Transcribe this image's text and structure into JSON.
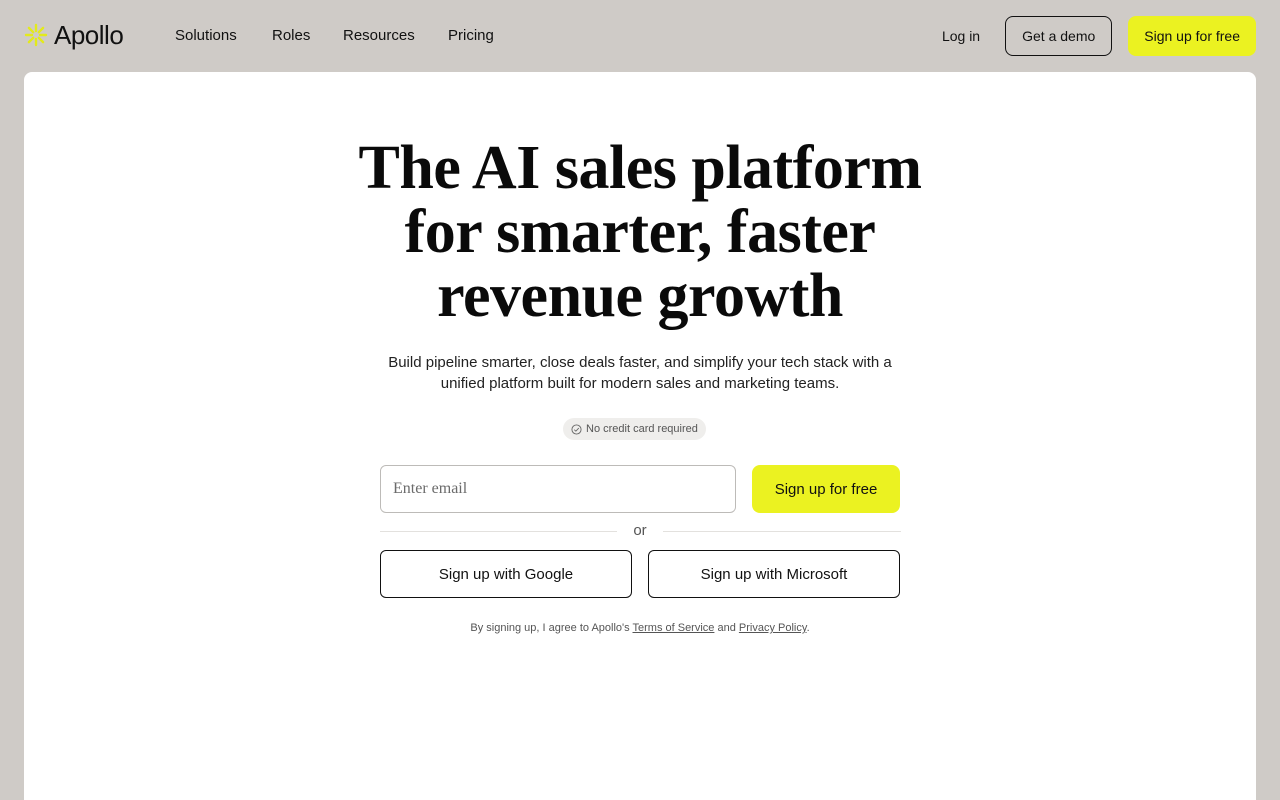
{
  "brand": {
    "name": "Apollo",
    "accent": "#ebf221"
  },
  "nav": {
    "items": [
      "Solutions",
      "Roles",
      "Resources",
      "Pricing"
    ]
  },
  "actions": {
    "login": "Log in",
    "demo": "Get a demo",
    "signup": "Sign up for free"
  },
  "hero": {
    "title": "The AI sales platform for smarter, faster revenue growth",
    "subtitle": "Build pipeline smarter, close deals faster, and simplify your tech stack with a unified platform built for modern sales and marketing teams.",
    "badge": "No credit card required",
    "badge_icon": "check-circle-icon"
  },
  "signup_form": {
    "email_placeholder": "Enter email",
    "email_value": "",
    "submit": "Sign up for free",
    "divider": "or",
    "google": "Sign up with Google",
    "microsoft": "Sign up with Microsoft"
  },
  "legal": {
    "prefix": "By signing up, I agree to Apollo's",
    "terms": "Terms of Service",
    "and": "and",
    "privacy": "Privacy Policy",
    "suffix": "."
  }
}
